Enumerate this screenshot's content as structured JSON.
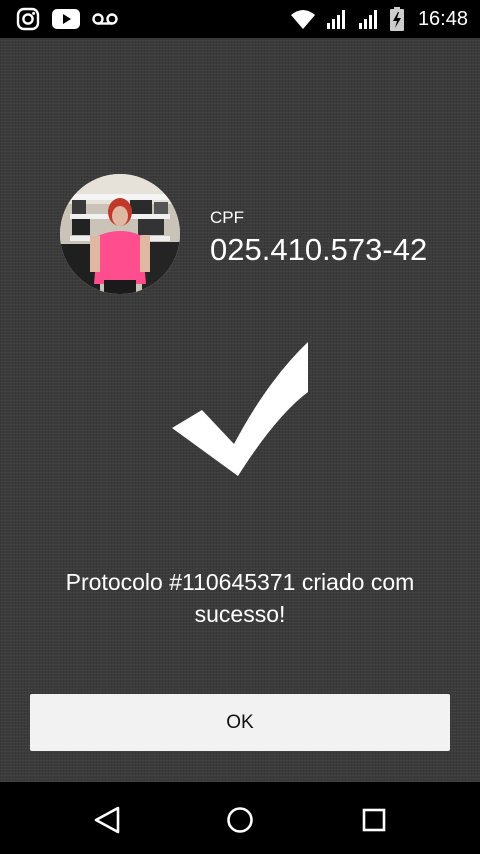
{
  "status_bar": {
    "time": "16:48",
    "left_icons": [
      "instagram-icon",
      "youtube-icon",
      "voicemail-icon"
    ],
    "right_icons": [
      "wifi-icon",
      "signal-icon",
      "signal-icon",
      "battery-charging-icon"
    ]
  },
  "profile": {
    "cpf_label": "CPF",
    "cpf_value": "025.410.573-42"
  },
  "result": {
    "icon": "checkmark-icon",
    "message": "Protocolo #110645371 criado com sucesso!"
  },
  "actions": {
    "ok_label": "OK"
  },
  "navigation": {
    "buttons": [
      "back-icon",
      "home-icon",
      "recents-icon"
    ]
  },
  "colors": {
    "background": "#3b3b3b",
    "button": "#f2f2f2",
    "text": "#ffffff"
  }
}
